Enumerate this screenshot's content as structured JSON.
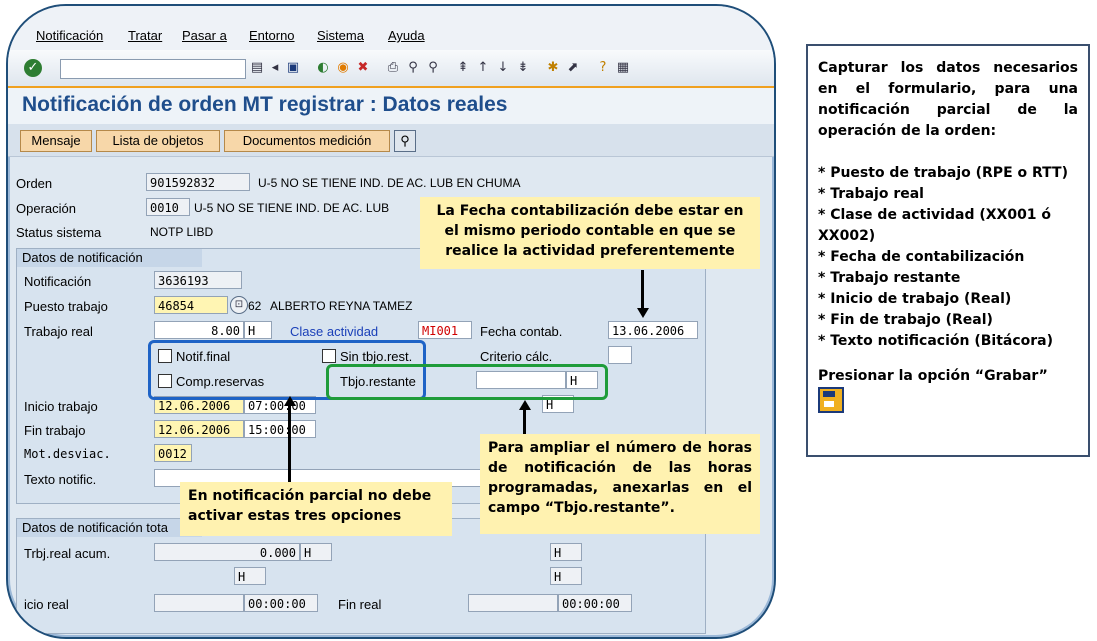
{
  "menu": [
    "Notificación",
    "Tratar",
    "Pasar a",
    "Entorno",
    "Sistema",
    "Ayuda"
  ],
  "page_title": "Notificación de orden MT registrar : Datos reales",
  "app_buttons": {
    "mensaje": "Mensaje",
    "lista_objetos": "Lista de objetos",
    "documentos": "Documentos medición"
  },
  "header": {
    "orden": {
      "label": "Orden",
      "value": "901592832",
      "text": "U-5 NO SE TIENE IND. DE AC. LUB EN CHUMA"
    },
    "operacion": {
      "label": "Operación",
      "value": "0010",
      "text": "U-5 NO SE TIENE IND. DE AC. LUB"
    },
    "status": {
      "label": "Status sistema",
      "value": "NOTP LIBD"
    }
  },
  "datos_notificacion": {
    "title": "Datos de notificación",
    "notificacion": {
      "label": "Notificación",
      "value": "3636193"
    },
    "puesto": {
      "label": "Puesto trabajo",
      "value": "46854",
      "code": "62",
      "name": "ALBERTO REYNA TAMEZ"
    },
    "trabajo_real": {
      "label": "Trabajo real",
      "value": "8.00",
      "unit": "H"
    },
    "clase_actividad": {
      "label": "Clase actividad",
      "value": "MI001"
    },
    "fecha_contab": {
      "label": "Fecha contab.",
      "value": "13.06.2006"
    },
    "notif_final": "Notif.final",
    "sin_tbjo": "Sin tbjo.rest.",
    "criterio": "Criterio cálc.",
    "comp_reservas": "Comp.reservas",
    "tbjo_restante": {
      "label": "Tbjo.restante",
      "unit": "H"
    },
    "extra_unit": "H",
    "inicio": {
      "label": "Inicio trabajo",
      "date": "12.06.2006",
      "time": "07:00:00"
    },
    "fin": {
      "label": "Fin trabajo",
      "date": "12.06.2006",
      "time": "15:00:00"
    },
    "mot_desv": {
      "label": "Mot.desviac.",
      "value": "0012"
    },
    "texto": {
      "label": "Texto notific."
    }
  },
  "datos_totales": {
    "title": "Datos de notificación tota",
    "trbj_acum": {
      "label": "Trbj.real acum.",
      "value": "0.000",
      "unit": "H"
    },
    "unit_right": "H",
    "unit_mid": "H",
    "unit_right2": "H",
    "inicio_real": {
      "label": "icio real",
      "time": "00:00:00"
    },
    "fin_real": {
      "label": "Fin real",
      "time": "00:00:00"
    }
  },
  "notes": {
    "fecha": "La Fecha contabilización debe estar en el mismo periodo contable en que se realice la actividad preferentemente",
    "parcial": "En notificación parcial no debe activar estas tres opciones",
    "ampliar": "Para ampliar el número de horas de notificación de las horas programadas, anexarlas en el campo “Tbjo.restante”."
  },
  "side_panel": {
    "intro": "Capturar los datos necesarios en el formulario, para una notificación parcial de la operación de la orden:",
    "items": [
      "* Puesto de trabajo (RPE o RTT)",
      "* Trabajo real",
      "* Clase de actividad (XX001 ó XX002)",
      "* Fecha de contabilización",
      "* Trabajo restante",
      "* Inicio de trabajo (Real)",
      "* Fin de trabajo (Real)",
      "* Texto notificación (Bitácora)"
    ],
    "final": "Presionar la opción “Grabar”"
  }
}
